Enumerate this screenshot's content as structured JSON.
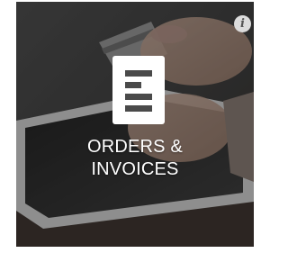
{
  "tile": {
    "title_line1": "ORDERS &",
    "title_line2": "INVOICES",
    "icon": "document-list-icon",
    "image": "hands holding credit card over tablet"
  },
  "info": {
    "icon": "info-icon",
    "glyph": "i"
  },
  "colors": {
    "title_text": "#ffffff",
    "icon_fill": "#ffffff",
    "info_bg": "#dcdcdc",
    "info_glyph": "#555555"
  }
}
